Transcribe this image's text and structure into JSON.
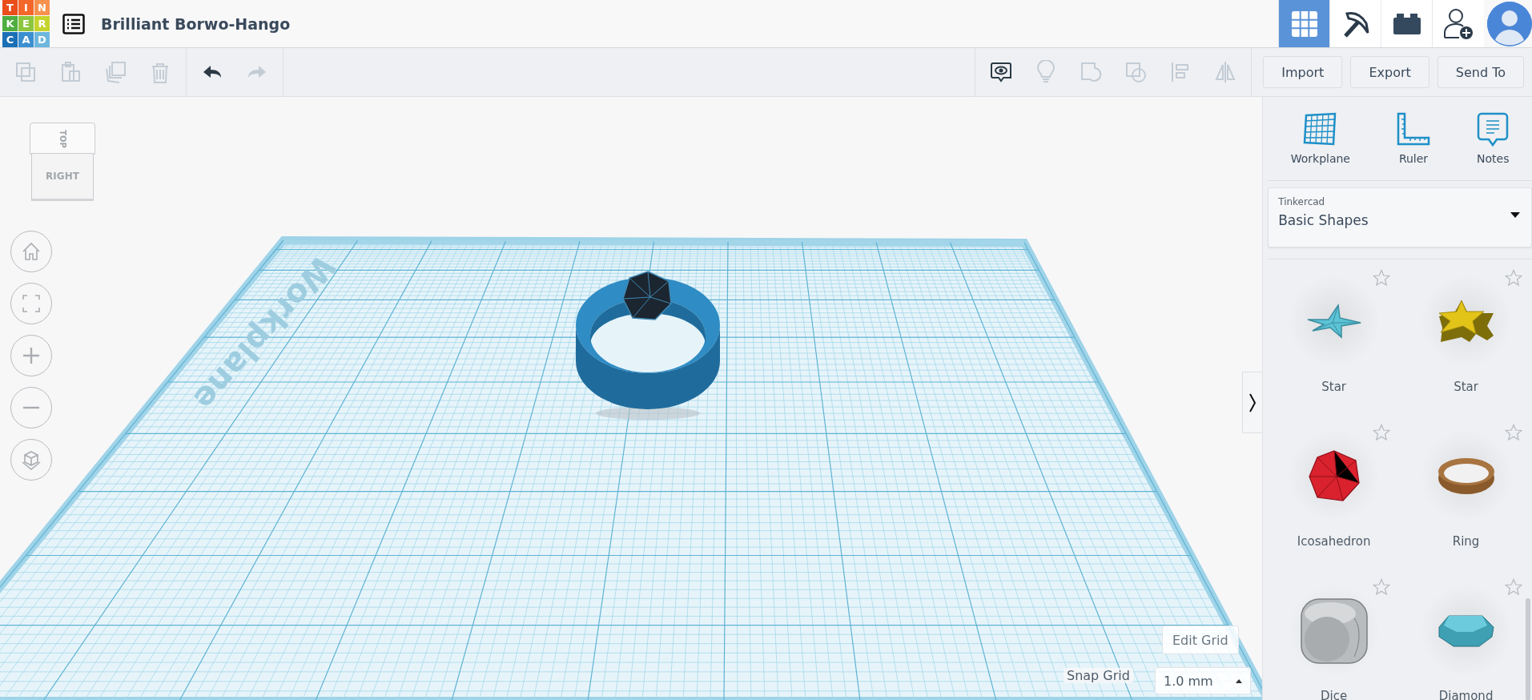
{
  "logo": {
    "letters": [
      "T",
      "I",
      "N",
      "K",
      "E",
      "R",
      "C",
      "A",
      "D"
    ]
  },
  "title": "Brilliant Borwo-Hango",
  "view_switch": [
    {
      "kind": "grid",
      "selected": true
    },
    {
      "kind": "pickaxe",
      "selected": false
    },
    {
      "kind": "bricks",
      "selected": false
    }
  ],
  "toolbar": {
    "edit_tools": [
      {
        "kind": "copy",
        "disabled": true
      },
      {
        "kind": "paste",
        "disabled": true
      },
      {
        "kind": "duplicate",
        "disabled": true
      },
      {
        "kind": "delete",
        "disabled": true
      }
    ],
    "history": [
      {
        "kind": "undo",
        "disabled": false
      },
      {
        "kind": "redo",
        "disabled": true
      }
    ],
    "shape_tools": [
      {
        "kind": "notes-toggle",
        "disabled": false
      },
      {
        "kind": "light-bulb",
        "disabled": true
      },
      {
        "kind": "group",
        "disabled": true
      },
      {
        "kind": "ungroup",
        "disabled": true
      },
      {
        "kind": "align",
        "disabled": true
      },
      {
        "kind": "mirror",
        "disabled": true
      }
    ],
    "buttons": [
      "Import",
      "Export",
      "Send To"
    ]
  },
  "view_cube": {
    "top": "TOP",
    "front": "RIGHT"
  },
  "workplane": {
    "label": "Workplane"
  },
  "edit_grid": "Edit Grid",
  "snap_grid": {
    "label": "Snap Grid",
    "value": "1.0 mm"
  },
  "panel": {
    "tools": [
      {
        "kind": "workplane",
        "label": "Workplane"
      },
      {
        "kind": "ruler",
        "label": "Ruler"
      },
      {
        "kind": "notes",
        "label": "Notes"
      }
    ],
    "library": {
      "label": "Tinkercad",
      "value": "Basic Shapes"
    },
    "shapes": [
      {
        "kind": "star-pyramid",
        "label": "Star",
        "favorite": false
      },
      {
        "kind": "star",
        "label": "Star",
        "favorite": false
      },
      {
        "kind": "icosahedron",
        "label": "Icosahedron",
        "favorite": false
      },
      {
        "kind": "ring",
        "label": "Ring",
        "favorite": false
      },
      {
        "kind": "dice",
        "label": "Dice",
        "favorite": false
      },
      {
        "kind": "diamond",
        "label": "Diamond",
        "favorite": false
      }
    ]
  }
}
